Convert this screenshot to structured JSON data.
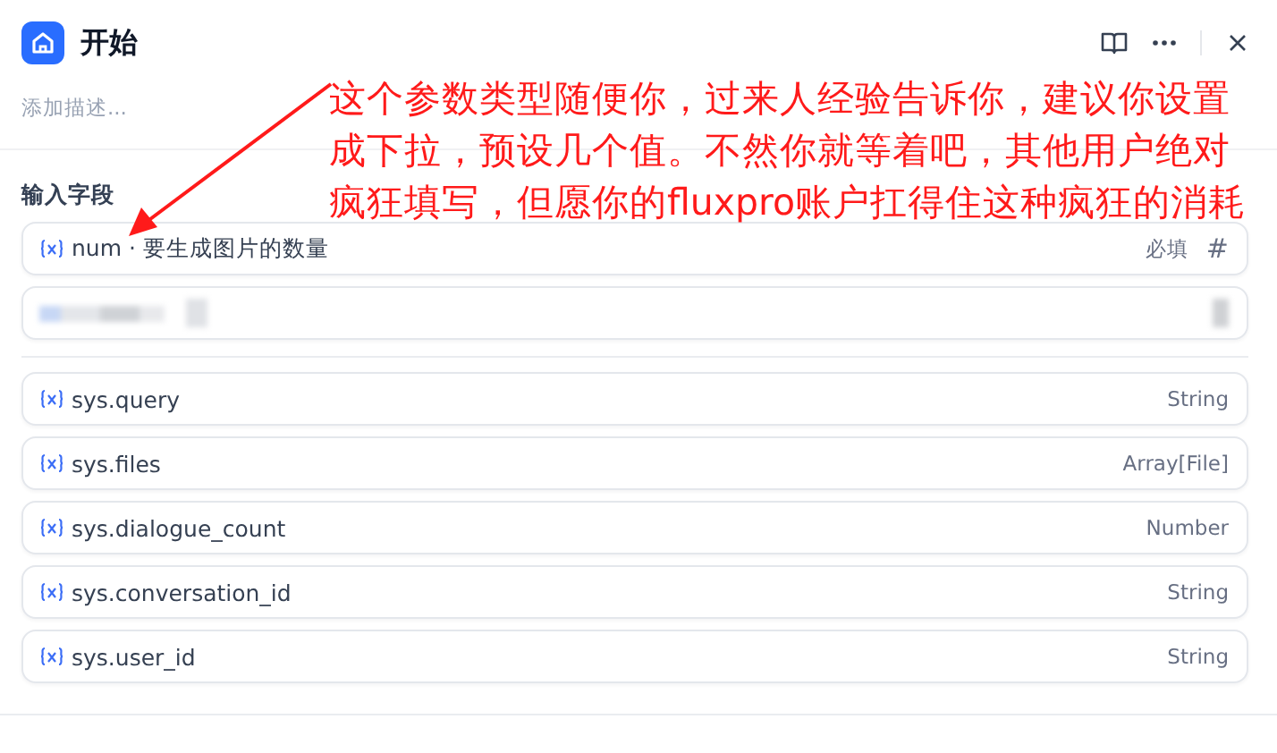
{
  "header": {
    "title": "开始",
    "description_placeholder": "添加描述..."
  },
  "section_title": "输入字段",
  "input_fields": [
    {
      "kind": "variable",
      "name": "num",
      "separator": "·",
      "description": "要生成图片的数量",
      "required_label": "必填",
      "type_symbol": "#"
    },
    {
      "kind": "blurred"
    }
  ],
  "system_variables": [
    {
      "name": "sys.query",
      "type": "String"
    },
    {
      "name": "sys.files",
      "type": "Array[File]"
    },
    {
      "name": "sys.dialogue_count",
      "type": "Number"
    },
    {
      "name": "sys.conversation_id",
      "type": "String"
    },
    {
      "name": "sys.user_id",
      "type": "String"
    }
  ],
  "annotation": {
    "lines": [
      "这个参数类型随便你，过来人经验告诉你，建议你设置",
      "成下拉，预设几个值。不然你就等着吧，其他用户绝对",
      "疯狂填写，但愿你的fluxpro账户扛得住这种疯狂的消耗"
    ]
  }
}
